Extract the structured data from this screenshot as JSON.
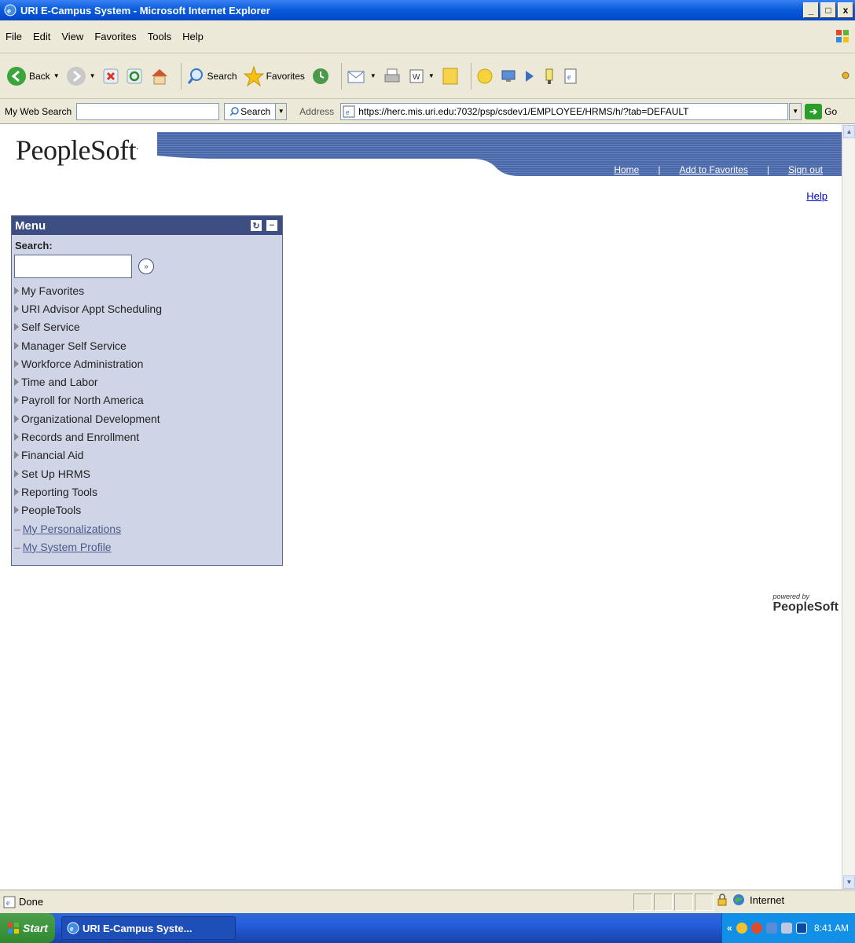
{
  "window": {
    "title": "URI E-Campus System - Microsoft Internet Explorer",
    "buttons": [
      "_",
      "□",
      "x"
    ]
  },
  "menubar": {
    "items": [
      "File",
      "Edit",
      "View",
      "Favorites",
      "Tools",
      "Help"
    ]
  },
  "toolbar": {
    "back_label": "Back",
    "search_label": "Search",
    "favorites_label": "Favorites"
  },
  "addressbar": {
    "web_search_label": "My Web Search",
    "web_search_value": "",
    "search_button_label": "Search",
    "address_label": "Address",
    "url": "https://herc.mis.uri.edu:7032/psp/csdev1/EMPLOYEE/HRMS/h/?tab=DEFAULT",
    "go_label": "Go"
  },
  "page": {
    "logo_text": "PeopleSoft",
    "nav_links": [
      "Home",
      "Add to Favorites",
      "Sign out"
    ],
    "help_label": "Help",
    "powered_by": "powered by",
    "powered_by_brand": "PeopleSoft"
  },
  "menu": {
    "title": "Menu",
    "search_label": "Search:",
    "search_value": "",
    "folders": [
      "My Favorites",
      "URI Advisor Appt Scheduling",
      "Self Service",
      "Manager Self Service",
      "Workforce Administration",
      "Time and Labor",
      "Payroll for North America",
      "Organizational Development",
      "Records and Enrollment",
      "Financial Aid",
      "Set Up HRMS",
      "Reporting Tools",
      "PeopleTools"
    ],
    "links": [
      "My Personalizations",
      "My System Profile"
    ]
  },
  "statusbar": {
    "status_text": "Done",
    "zone_label": "Internet"
  },
  "taskbar": {
    "start_label": "Start",
    "task_label": "URI E-Campus Syste...",
    "clock": "8:41 AM"
  },
  "colors": {
    "titlebar": "#0a5ddc",
    "menu_header": "#3c4e82",
    "menu_bg": "#d0d4e7",
    "banner": "#3e5a9c"
  }
}
